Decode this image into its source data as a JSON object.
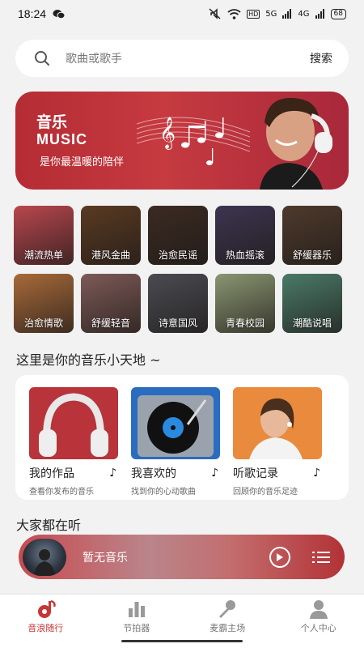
{
  "status": {
    "time": "18:24",
    "battery": "68",
    "hd": "HD",
    "net1": "5G",
    "net2": "4G"
  },
  "search": {
    "placeholder": "歌曲或歌手",
    "button": "搜索"
  },
  "banner": {
    "title_cn": "音乐",
    "title_en": "MUSIC",
    "tagline": "是你最温暖的陪伴"
  },
  "categories": [
    {
      "label": "潮流热单",
      "bg": "#b8474e"
    },
    {
      "label": "港风金曲",
      "bg": "#5a3a22"
    },
    {
      "label": "治愈民谣",
      "bg": "#3b2a22"
    },
    {
      "label": "热血摇滚",
      "bg": "#3d3550"
    },
    {
      "label": "舒缓器乐",
      "bg": "#4e3a2c"
    },
    {
      "label": "治愈情歌",
      "bg": "#a86a3a"
    },
    {
      "label": "舒缓轻音",
      "bg": "#7d5a57"
    },
    {
      "label": "诗意国风",
      "bg": "#4a4b52"
    },
    {
      "label": "青春校园",
      "bg": "#8a9672"
    },
    {
      "label": "潮酷说唱",
      "bg": "#4a7a68"
    }
  ],
  "section1": "这里是你的音乐小天地 ~",
  "cards": [
    {
      "name": "我的作品",
      "desc": "查看你发布的音乐"
    },
    {
      "name": "我喜欢的",
      "desc": "找到你的心动歌曲"
    },
    {
      "name": "听歌记录",
      "desc": "回顾你的音乐足迹"
    }
  ],
  "section2": "大家都在听",
  "player": {
    "song": "暂无音乐"
  },
  "tabs": [
    {
      "label": "音浪随行",
      "icon": "music-note-icon"
    },
    {
      "label": "节拍器",
      "icon": "bar-chart-icon"
    },
    {
      "label": "麦霸主场",
      "icon": "microphone-icon"
    },
    {
      "label": "个人中心",
      "icon": "person-icon"
    }
  ],
  "colors": {
    "accent": "#c83636",
    "background": "#f2f2f2"
  }
}
